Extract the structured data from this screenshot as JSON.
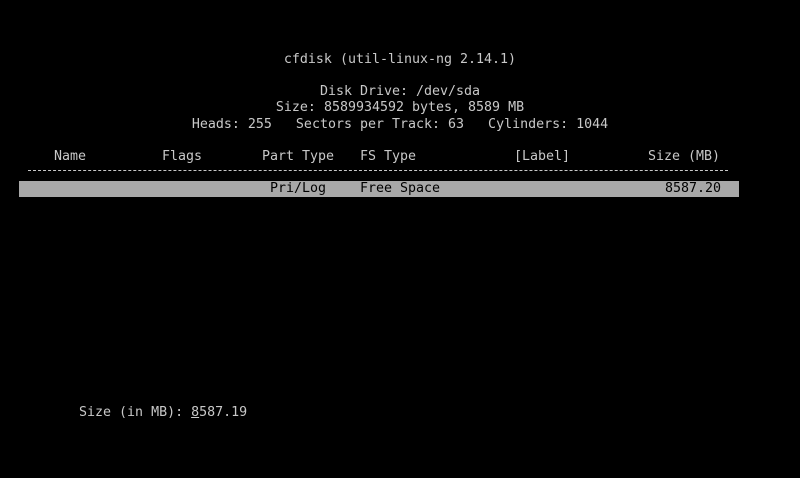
{
  "header": {
    "title": "cfdisk (util-linux-ng 2.14.1)",
    "disk_drive": "Disk Drive: /dev/sda",
    "size_line": "Size: 8589934592 bytes, 8589 MB",
    "geometry_line": "Heads: 255   Sectors per Track: 63   Cylinders: 1044"
  },
  "table": {
    "columns": [
      "Name",
      "Flags",
      "Part Type",
      "FS Type",
      "[Label]",
      "Size (MB)"
    ],
    "rows": [
      {
        "name": "",
        "flags": "",
        "part_type": "Pri/Log",
        "fs_type": "Free Space",
        "label": "",
        "size_mb": "8587.20",
        "selected": true
      }
    ]
  },
  "prompt": {
    "label": "Size (in MB): ",
    "value_first_char": "8",
    "value_rest": "587.19"
  },
  "colors": {
    "background": "#000000",
    "foreground": "#c8c8c8",
    "highlight": "#a8a8a8"
  }
}
